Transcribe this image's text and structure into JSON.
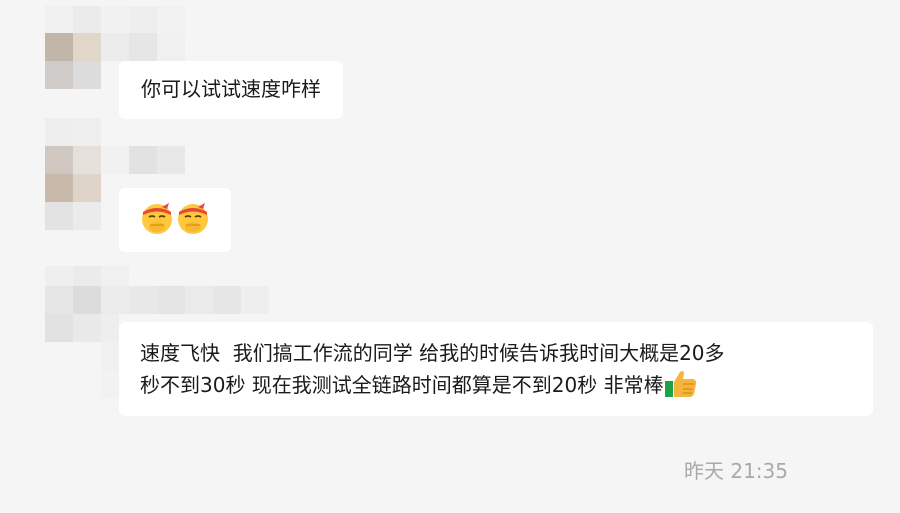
{
  "conversation": {
    "messages": [
      {
        "sender": "contact",
        "text": "你可以试试速度咋样"
      },
      {
        "sender": "contact",
        "emojis": [
          "face-with-bandage-hand-over-mouth-emoji",
          "face-with-bandage-hand-over-mouth-emoji"
        ]
      },
      {
        "sender": "contact",
        "line1": "速度飞快  我们搞工作流的同学 给我的时候告诉我时间大概是20多",
        "line2": "秒不到30秒 现在我测试全链路时间都算是不到20秒 非常棒",
        "trailing_emojis": [
          "thumbs-up-icon"
        ]
      }
    ],
    "timestamp": "昨天 21:35"
  },
  "colors": {
    "background": "#f5f5f5",
    "bubble": "#ffffff",
    "text": "#1a1a1a",
    "timestamp": "#a9a9a9"
  }
}
